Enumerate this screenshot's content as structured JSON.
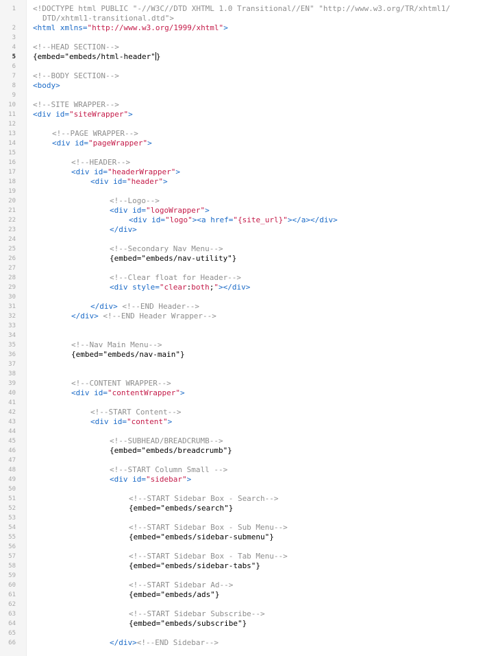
{
  "editor": {
    "active_line": 5,
    "lines": [
      {
        "n": "1",
        "indent": 0,
        "parts": [
          [
            "c",
            "<!DOCTYPE html PUBLIC \"-//W3C//DTD XHTML 1.0 Transitional//EN\" \"http://www.w3.org/TR/xhtml1/"
          ]
        ]
      },
      {
        "n": "",
        "indent": 1,
        "parts": [
          [
            "c",
            "DTD/xhtml1-transitional.dtd\">"
          ]
        ]
      },
      {
        "n": "2",
        "indent": 0,
        "parts": [
          [
            "t",
            "<html "
          ],
          [
            "a",
            "xmlns="
          ],
          [
            "s",
            "\"http://www.w3.org/1999/xhtml\""
          ],
          [
            "t",
            ">"
          ]
        ]
      },
      {
        "n": "3",
        "indent": 0,
        "parts": []
      },
      {
        "n": "4",
        "indent": 0,
        "parts": [
          [
            "c",
            "<!--HEAD SECTION-->"
          ]
        ]
      },
      {
        "n": "5",
        "indent": 0,
        "parts": [
          [
            "p",
            "{embed=\"embeds/html-header\""
          ],
          [
            "cur",
            ""
          ],
          [
            "p",
            "}"
          ]
        ]
      },
      {
        "n": "6",
        "indent": 0,
        "parts": []
      },
      {
        "n": "7",
        "indent": 0,
        "parts": [
          [
            "c",
            "<!--BODY SECTION-->"
          ]
        ]
      },
      {
        "n": "8",
        "indent": 0,
        "parts": [
          [
            "t",
            "<body>"
          ]
        ]
      },
      {
        "n": "9",
        "indent": 0,
        "parts": []
      },
      {
        "n": "10",
        "indent": 0,
        "parts": [
          [
            "c",
            "<!--SITE WRAPPER-->"
          ]
        ]
      },
      {
        "n": "11",
        "indent": 0,
        "parts": [
          [
            "t",
            "<div "
          ],
          [
            "a",
            "id="
          ],
          [
            "s",
            "\"siteWrapper\""
          ],
          [
            "t",
            ">"
          ]
        ]
      },
      {
        "n": "12",
        "indent": 0,
        "parts": []
      },
      {
        "n": "13",
        "indent": 1,
        "parts": [
          [
            "c",
            "<!--PAGE WRAPPER-->"
          ]
        ]
      },
      {
        "n": "14",
        "indent": 1,
        "parts": [
          [
            "t",
            "<div "
          ],
          [
            "a",
            "id="
          ],
          [
            "s",
            "\"pageWrapper\""
          ],
          [
            "t",
            ">"
          ]
        ]
      },
      {
        "n": "15",
        "indent": 0,
        "parts": []
      },
      {
        "n": "16",
        "indent": 2,
        "parts": [
          [
            "c",
            "<!--HEADER-->"
          ]
        ]
      },
      {
        "n": "17",
        "indent": 2,
        "parts": [
          [
            "t",
            "<div "
          ],
          [
            "a",
            "id="
          ],
          [
            "s",
            "\"headerWrapper\""
          ],
          [
            "t",
            ">"
          ]
        ]
      },
      {
        "n": "18",
        "indent": 3,
        "parts": [
          [
            "t",
            "<div "
          ],
          [
            "a",
            "id="
          ],
          [
            "s",
            "\"header\""
          ],
          [
            "t",
            ">"
          ]
        ]
      },
      {
        "n": "19",
        "indent": 0,
        "parts": []
      },
      {
        "n": "20",
        "indent": 4,
        "parts": [
          [
            "c",
            "<!--Logo-->"
          ]
        ]
      },
      {
        "n": "21",
        "indent": 4,
        "parts": [
          [
            "t",
            "<div "
          ],
          [
            "a",
            "id="
          ],
          [
            "s",
            "\"logoWrapper\""
          ],
          [
            "t",
            ">"
          ]
        ]
      },
      {
        "n": "22",
        "indent": 5,
        "parts": [
          [
            "t",
            "<div "
          ],
          [
            "a",
            "id="
          ],
          [
            "s",
            "\"logo\""
          ],
          [
            "t",
            "><a "
          ],
          [
            "a",
            "href="
          ],
          [
            "s",
            "\"{site_url}\""
          ],
          [
            "t",
            "></a></div>"
          ]
        ]
      },
      {
        "n": "23",
        "indent": 4,
        "parts": [
          [
            "t",
            "</div>"
          ]
        ]
      },
      {
        "n": "24",
        "indent": 0,
        "parts": []
      },
      {
        "n": "25",
        "indent": 4,
        "parts": [
          [
            "c",
            "<!--Secondary Nav Menu-->"
          ]
        ]
      },
      {
        "n": "26",
        "indent": 4,
        "parts": [
          [
            "p",
            "{embed=\"embeds/nav-utility\"}"
          ]
        ]
      },
      {
        "n": "27",
        "indent": 0,
        "parts": []
      },
      {
        "n": "28",
        "indent": 4,
        "parts": [
          [
            "c",
            "<!--Clear float for Header-->"
          ]
        ]
      },
      {
        "n": "29",
        "indent": 4,
        "parts": [
          [
            "t",
            "<div "
          ],
          [
            "a",
            "style="
          ],
          [
            "s",
            "\"clear"
          ],
          [
            "p",
            ":"
          ],
          [
            "s",
            "both"
          ],
          [
            "p",
            ";"
          ],
          [
            "s",
            "\""
          ],
          [
            "t",
            "></div>"
          ]
        ]
      },
      {
        "n": "30",
        "indent": 0,
        "parts": []
      },
      {
        "n": "31",
        "indent": 3,
        "parts": [
          [
            "t",
            "</div> "
          ],
          [
            "c",
            "<!--END Header-->"
          ]
        ]
      },
      {
        "n": "32",
        "indent": 2,
        "parts": [
          [
            "t",
            "</div> "
          ],
          [
            "c",
            "<!--END Header Wrapper-->"
          ]
        ]
      },
      {
        "n": "33",
        "indent": 0,
        "parts": []
      },
      {
        "n": "34",
        "indent": 0,
        "parts": []
      },
      {
        "n": "35",
        "indent": 2,
        "parts": [
          [
            "c",
            "<!--Nav Main Menu-->"
          ]
        ]
      },
      {
        "n": "36",
        "indent": 2,
        "parts": [
          [
            "p",
            "{embed=\"embeds/nav-main\"}"
          ]
        ]
      },
      {
        "n": "37",
        "indent": 0,
        "parts": []
      },
      {
        "n": "38",
        "indent": 0,
        "parts": []
      },
      {
        "n": "39",
        "indent": 2,
        "parts": [
          [
            "c",
            "<!--CONTENT WRAPPER-->"
          ]
        ]
      },
      {
        "n": "40",
        "indent": 2,
        "parts": [
          [
            "t",
            "<div "
          ],
          [
            "a",
            "id="
          ],
          [
            "s",
            "\"contentWrapper\""
          ],
          [
            "t",
            ">"
          ]
        ]
      },
      {
        "n": "41",
        "indent": 0,
        "parts": []
      },
      {
        "n": "42",
        "indent": 3,
        "parts": [
          [
            "c",
            "<!--START Content-->"
          ]
        ]
      },
      {
        "n": "43",
        "indent": 3,
        "parts": [
          [
            "t",
            "<div "
          ],
          [
            "a",
            "id="
          ],
          [
            "s",
            "\"content\""
          ],
          [
            "t",
            ">"
          ]
        ]
      },
      {
        "n": "44",
        "indent": 0,
        "parts": []
      },
      {
        "n": "45",
        "indent": 4,
        "parts": [
          [
            "c",
            "<!--SUBHEAD/BREADCRUMB-->"
          ]
        ]
      },
      {
        "n": "46",
        "indent": 4,
        "parts": [
          [
            "p",
            "{embed=\"embeds/breadcrumb\"}"
          ]
        ]
      },
      {
        "n": "47",
        "indent": 0,
        "parts": []
      },
      {
        "n": "48",
        "indent": 4,
        "parts": [
          [
            "c",
            "<!--START Column Small -->"
          ]
        ]
      },
      {
        "n": "49",
        "indent": 4,
        "parts": [
          [
            "t",
            "<div "
          ],
          [
            "a",
            "id="
          ],
          [
            "s",
            "\"sidebar\""
          ],
          [
            "t",
            ">"
          ]
        ]
      },
      {
        "n": "50",
        "indent": 0,
        "parts": []
      },
      {
        "n": "51",
        "indent": 5,
        "parts": [
          [
            "c",
            "<!--START Sidebar Box - Search-->"
          ]
        ]
      },
      {
        "n": "52",
        "indent": 5,
        "parts": [
          [
            "p",
            "{embed=\"embeds/search\"}"
          ]
        ]
      },
      {
        "n": "53",
        "indent": 0,
        "parts": []
      },
      {
        "n": "54",
        "indent": 5,
        "parts": [
          [
            "c",
            "<!--START Sidebar Box - Sub Menu-->"
          ]
        ]
      },
      {
        "n": "55",
        "indent": 5,
        "parts": [
          [
            "p",
            "{embed=\"embeds/sidebar-submenu\"}"
          ]
        ]
      },
      {
        "n": "56",
        "indent": 0,
        "parts": []
      },
      {
        "n": "57",
        "indent": 5,
        "parts": [
          [
            "c",
            "<!--START Sidebar Box - Tab Menu-->"
          ]
        ]
      },
      {
        "n": "58",
        "indent": 5,
        "parts": [
          [
            "p",
            "{embed=\"embeds/sidebar-tabs\"}"
          ]
        ]
      },
      {
        "n": "59",
        "indent": 0,
        "parts": []
      },
      {
        "n": "60",
        "indent": 5,
        "parts": [
          [
            "c",
            "<!--START Sidebar Ad-->"
          ]
        ]
      },
      {
        "n": "61",
        "indent": 5,
        "parts": [
          [
            "p",
            "{embed=\"embeds/ads\"}"
          ]
        ]
      },
      {
        "n": "62",
        "indent": 0,
        "parts": []
      },
      {
        "n": "63",
        "indent": 5,
        "parts": [
          [
            "c",
            "<!--START Sidebar Subscribe-->"
          ]
        ]
      },
      {
        "n": "64",
        "indent": 5,
        "parts": [
          [
            "p",
            "{embed=\"embeds/subscribe\"}"
          ]
        ]
      },
      {
        "n": "65",
        "indent": 0,
        "parts": []
      },
      {
        "n": "66",
        "indent": 4,
        "parts": [
          [
            "t",
            "</div>"
          ],
          [
            "c",
            "<!--END Sidebar-->"
          ]
        ]
      }
    ]
  },
  "colors": {
    "comment": "#8e8e8e",
    "tag": "#1a6ac7",
    "string": "#c41a48",
    "text": "#000000",
    "gutter_bg": "#f5f5f5",
    "line_number": "#a8a8a8"
  }
}
